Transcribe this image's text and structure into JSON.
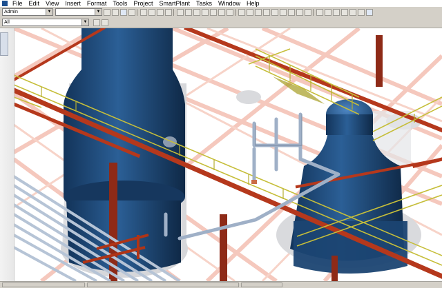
{
  "menu": {
    "items": [
      "File",
      "Edit",
      "View",
      "Insert",
      "Format",
      "Tools",
      "Project",
      "SmartPlant",
      "Tasks",
      "Window",
      "Help"
    ]
  },
  "toolbar": {
    "permission_group": "Admin",
    "active_filter": "",
    "locate_filter": "All"
  },
  "icons": {
    "app": "app-icon",
    "help": "help-icon"
  },
  "colors": {
    "equipment_blue": "#1e4573",
    "handrail_yellow": "#c9c23a",
    "steel_red": "#b83a1e",
    "ghost_steel": "#f1b7a7",
    "pipe_gray": "#9fb0c7"
  }
}
